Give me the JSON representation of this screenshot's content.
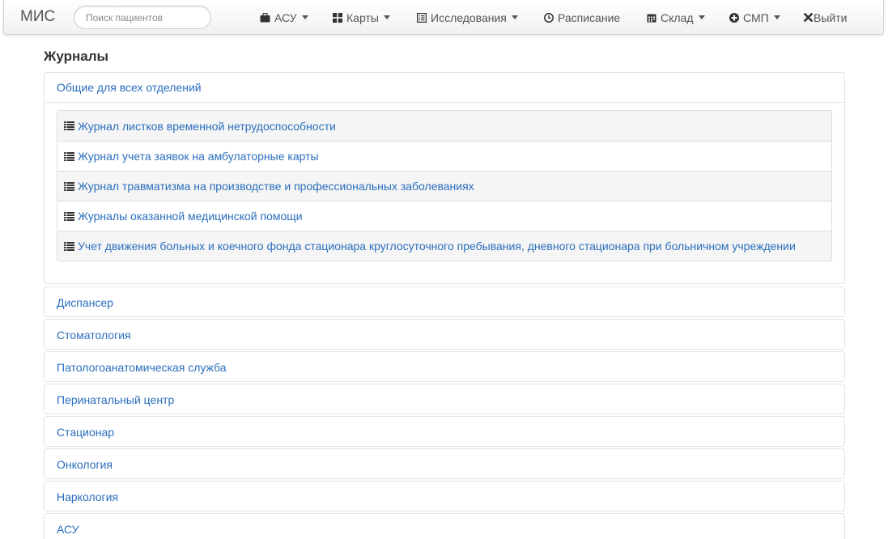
{
  "navbar": {
    "brand": "МИС",
    "search_placeholder": "Поиск пациентов",
    "items": [
      {
        "label": "АСУ",
        "icon": "briefcase-icon",
        "dropdown": true
      },
      {
        "label": "Карты",
        "icon": "th-large-icon",
        "dropdown": true
      },
      {
        "label": "Исследования",
        "icon": "list-alt-icon",
        "dropdown": true
      },
      {
        "label": "Расписание",
        "icon": "clock-icon",
        "dropdown": false
      },
      {
        "label": "Склад",
        "icon": "calendar-icon",
        "dropdown": true
      },
      {
        "label": "СМП",
        "icon": "plus-sign-icon",
        "dropdown": true
      },
      {
        "label": "Выйти",
        "icon": "remove-icon",
        "dropdown": false
      }
    ]
  },
  "page": {
    "title": "Журналы"
  },
  "journals": {
    "open_group": {
      "title": "Общие для всех отделений",
      "items": [
        "Журнал листков временной нетрудоспособности",
        "Журнал учета заявок на амбулаторные карты",
        "Журнал травматизма на производстве и профессиональных заболеваниях",
        "Журналы оказанной медицинской помощи",
        "Учет движения больных и коечного фонда стационара круглосуточного пребывания, дневного стационара при больничном учреждении"
      ]
    },
    "groups": [
      "Диспансер",
      "Стоматология",
      "Патологоанатомическая служба",
      "Перинатальный центр",
      "Стационар",
      "Онкология",
      "Наркология",
      "АСУ"
    ]
  },
  "colors": {
    "link": "#2a6ebd",
    "text": "#333333",
    "nav_text": "#555555",
    "stripe": "#f5f5f5"
  }
}
